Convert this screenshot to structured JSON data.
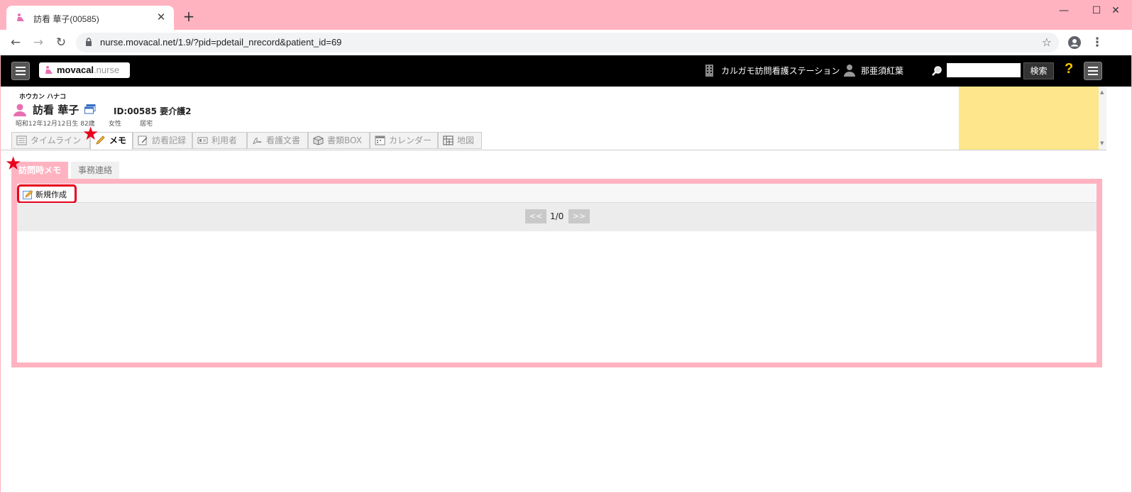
{
  "browser": {
    "tab_title": "訪看 華子(00585)",
    "tab_close": "✕",
    "new_tab": "+",
    "url": "nurse.movacal.net/1.9/?pid=pdetail_nrecord&patient_id=69",
    "window_controls": {
      "minimize": "—",
      "maximize": "☐",
      "close": "✕"
    },
    "back": "←",
    "forward": "→",
    "reload": "↻",
    "bookmark": "☆",
    "more": "⋮"
  },
  "app": {
    "logo_main": "movacal",
    "logo_sub": ".nurse",
    "station": "カルガモ訪問看護ステーション",
    "user": "那亜須紅葉",
    "search_placeholder": "",
    "search_button": "検索",
    "help": "?"
  },
  "patient": {
    "kana": "ホウカン ハナコ",
    "name": "訪看 華子",
    "id_care": "ID:00585 要介護2",
    "birth": "昭和12年12月12日生 82歳",
    "sex": "女性",
    "living": "居宅"
  },
  "tabs": [
    {
      "label": "タイムライン"
    },
    {
      "label": "メモ"
    },
    {
      "label": "訪看記録"
    },
    {
      "label": "利用者"
    },
    {
      "label": "看護文書"
    },
    {
      "label": "書類BOX"
    },
    {
      "label": "カレンダー"
    },
    {
      "label": "地図"
    }
  ],
  "subtabs": [
    {
      "label": "訪問時メモ"
    },
    {
      "label": "事務連絡"
    }
  ],
  "toolbar": {
    "new_button": "新規作成"
  },
  "pager": {
    "prev": "<<",
    "page": "1/0",
    "next": ">>"
  },
  "colors": {
    "accent_pink": "#ffb3c1",
    "highlight_red": "#e8001c",
    "note_yellow": "#fde68b"
  }
}
